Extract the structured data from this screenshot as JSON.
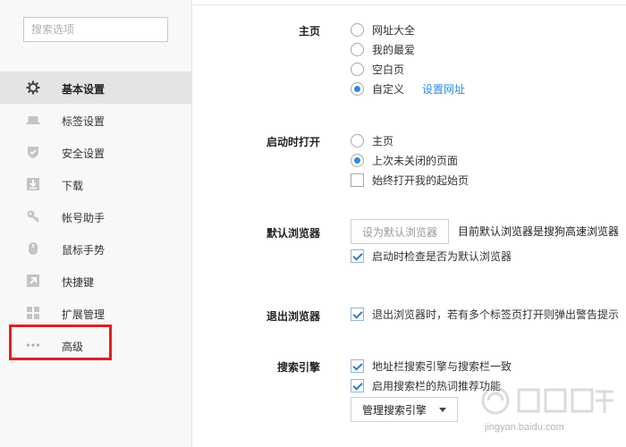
{
  "sidebar": {
    "search_placeholder": "搜索选项",
    "items": [
      {
        "label": "基本设置",
        "icon": "gear-icon",
        "active": true
      },
      {
        "label": "标签设置",
        "icon": "laptop-icon"
      },
      {
        "label": "安全设置",
        "icon": "shield-icon"
      },
      {
        "label": "下载",
        "icon": "download-icon"
      },
      {
        "label": "帐号助手",
        "icon": "key-icon"
      },
      {
        "label": "鼠标手势",
        "icon": "mouse-icon"
      },
      {
        "label": "快捷键",
        "icon": "shortcut-arrow-icon"
      },
      {
        "label": "扩展管理",
        "icon": "extensions-grid-icon"
      },
      {
        "label": "高级",
        "icon": "more-dots-icon"
      }
    ]
  },
  "sections": {
    "homepage": {
      "title": "主页",
      "options": [
        {
          "label": "网址大全",
          "selected": false
        },
        {
          "label": "我的最爱",
          "selected": false
        },
        {
          "label": "空白页",
          "selected": false
        },
        {
          "label": "自定义",
          "selected": true
        }
      ],
      "set_url_link": "设置网址"
    },
    "startup": {
      "title": "启动时打开",
      "options": [
        {
          "label": "主页",
          "selected": false
        },
        {
          "label": "上次未关闭的页面",
          "selected": true
        }
      ],
      "always_open_label": "始终打开我的起始页",
      "always_open_checked": false
    },
    "default_browser": {
      "title": "默认浏览器",
      "button_label": "设为默认浏览器",
      "status": "目前默认浏览器是搜狗高速浏览器",
      "check_on_start_label": "启动时检查是否为默认浏览器",
      "check_on_start_checked": true
    },
    "exit_browser": {
      "title": "退出浏览器",
      "warn_label": "退出浏览器时，若有多个标签页打开则弹出警告提示",
      "warn_checked": true
    },
    "search_engine": {
      "title": "搜索引擎",
      "sync_label": "地址栏搜索引擎与搜索栏一致",
      "sync_checked": true,
      "hot_words_label": "启用搜索栏的热词推荐功能",
      "hot_words_checked": true,
      "manage_button": "管理搜索引擎"
    }
  },
  "watermark": {
    "text": "jingyan.baidu.com"
  },
  "colors": {
    "accent": "#2e8ae6",
    "highlight": "#e02020",
    "sidebar_bg": "#f8f8f8",
    "active_bg": "#e4e4e4"
  }
}
